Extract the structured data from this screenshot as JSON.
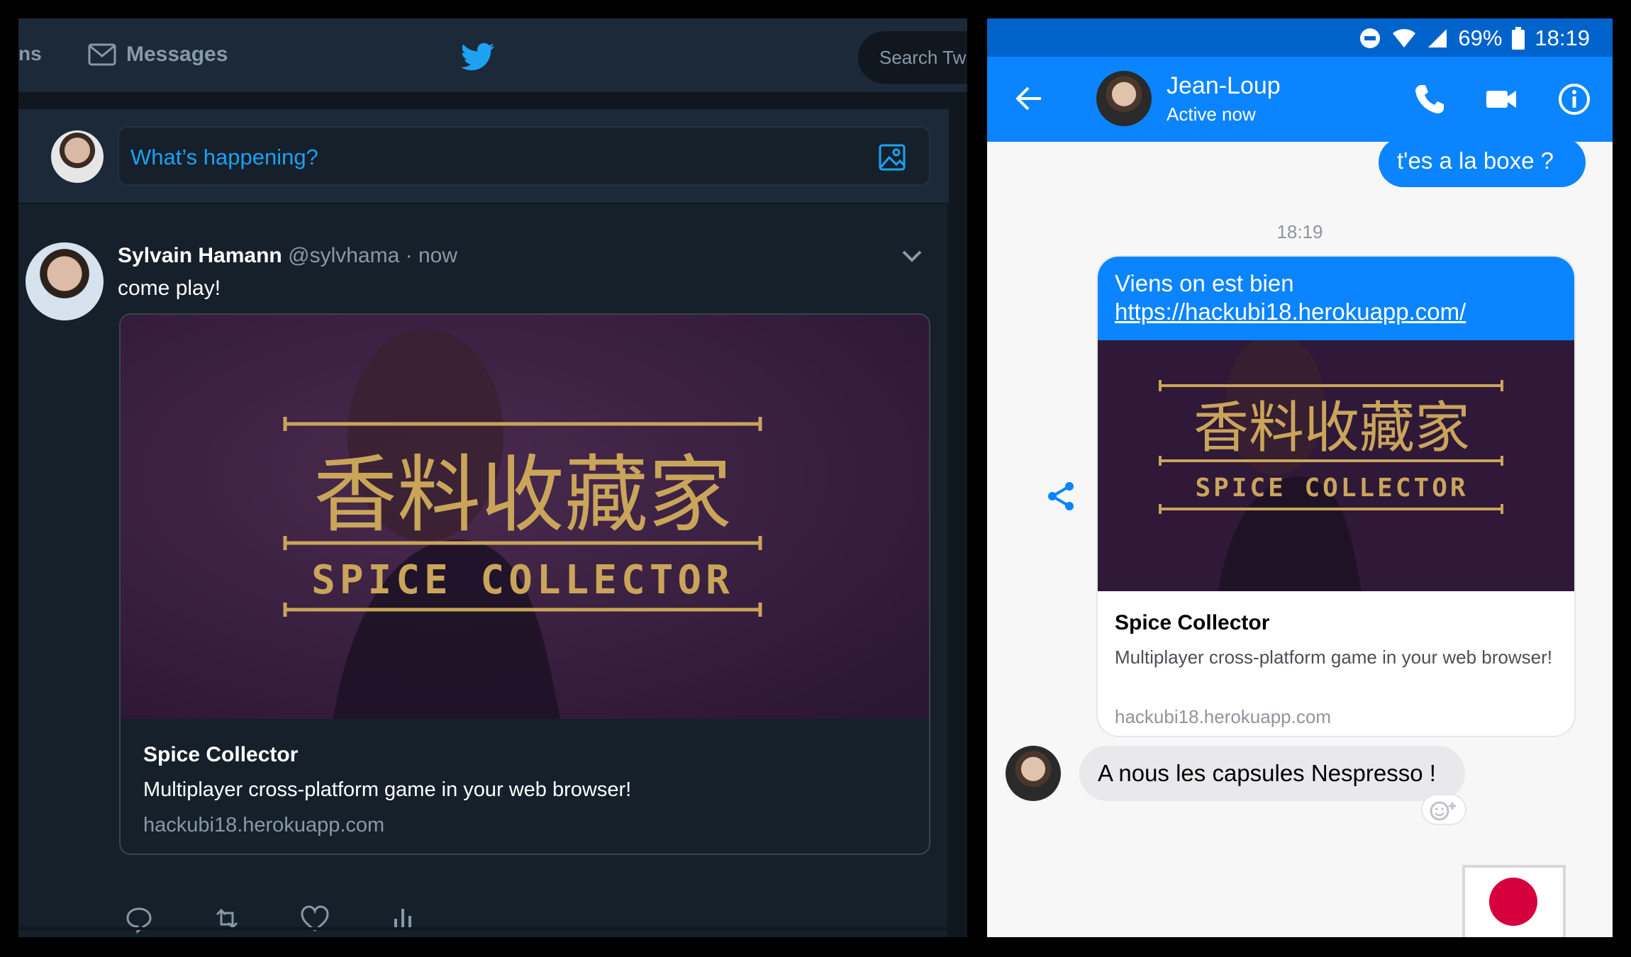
{
  "twitter": {
    "nav": {
      "notifications_partial": "ns",
      "messages": "Messages",
      "search_placeholder": "Search Twi"
    },
    "composer": {
      "placeholder": "What’s happening?"
    },
    "tweet": {
      "name": "Sylvain Hamann",
      "handle": "@sylvhama",
      "time": "· now",
      "text": "come play!",
      "card": {
        "title": "Spice Collector",
        "description": "Multiplayer cross-platform game in your web browser!",
        "domain": "hackubi18.herokuapp.com",
        "banner_cn": "香料收藏家",
        "banner_en": "SPICE COLLECTOR"
      }
    },
    "colors": {
      "accent": "#1da1f2",
      "bg": "#15202b",
      "nav": "#1c2938"
    }
  },
  "messenger": {
    "status": {
      "battery": "69%",
      "time": "18:19"
    },
    "header": {
      "name": "Jean-Loup",
      "status": "Active now"
    },
    "messages": {
      "out1": "t'es a la boxe ?",
      "timestamp": "18:19",
      "out2_line1": "Viens on est bien",
      "out2_link": "https://hackubi18.herokuapp.com/",
      "card": {
        "title": "Spice Collector",
        "description": "Multiplayer cross-platform game in your web browser!",
        "domain": "hackubi18.herokuapp.com",
        "banner_cn": "香料收藏家",
        "banner_en": "SPICE COLLECTOR"
      },
      "in1": "A nous les capsules Nespresso !"
    },
    "colors": {
      "accent": "#0b84ff",
      "status_bar": "#0063cc",
      "sticker": "#d6003f"
    }
  }
}
